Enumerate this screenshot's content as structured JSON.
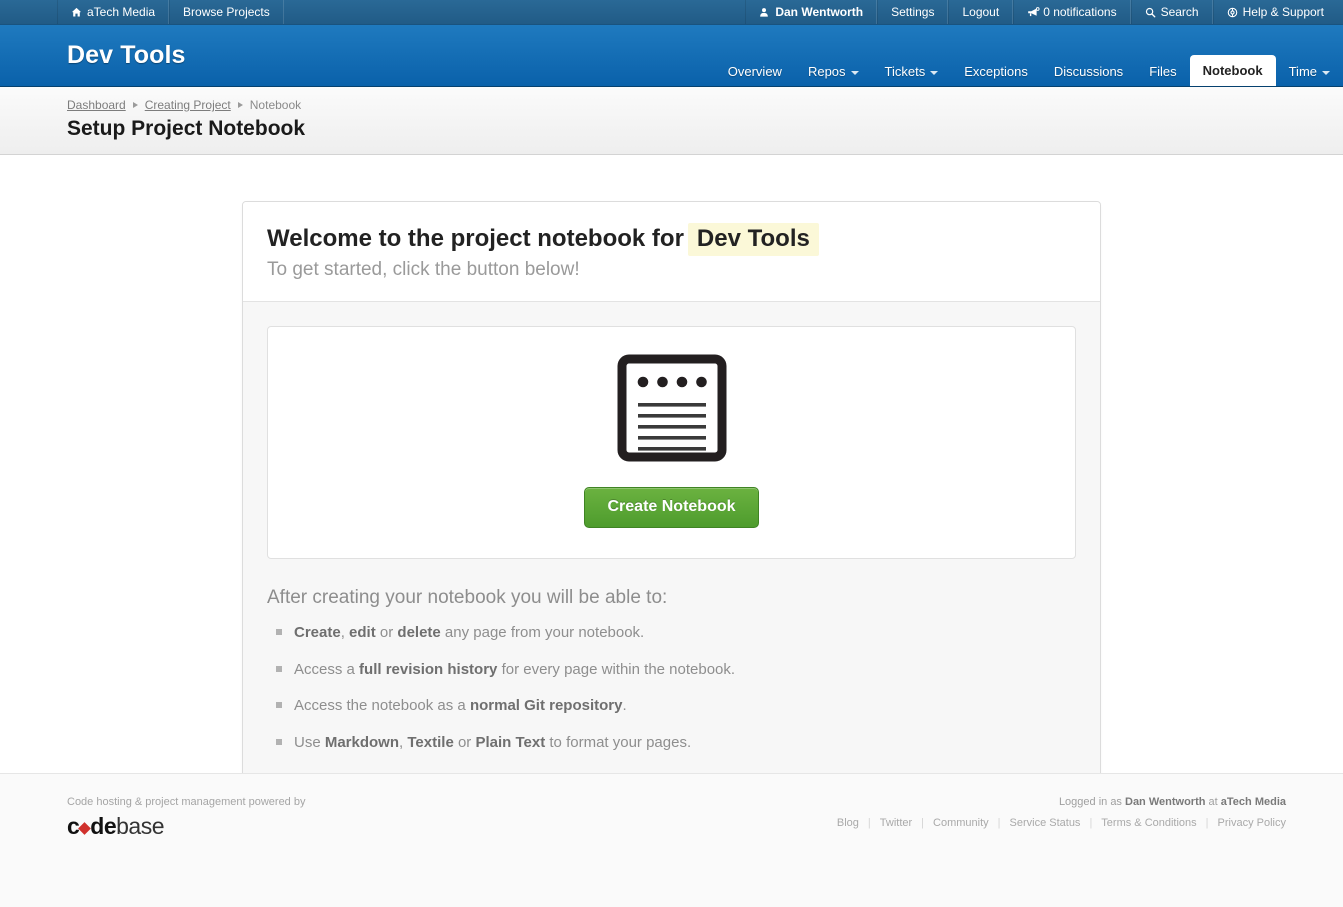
{
  "topbar": {
    "left": [
      {
        "label": "aTech Media",
        "icon": "home-icon",
        "name": "atech-media-link"
      },
      {
        "label": "Browse Projects",
        "icon": null,
        "name": "browse-projects-link"
      }
    ],
    "right": [
      {
        "label": "Dan Wentworth",
        "icon": "user-icon",
        "name": "account-user-link",
        "bold": true
      },
      {
        "label": "Settings",
        "icon": null,
        "name": "settings-link",
        "bold": false
      },
      {
        "label": "Logout",
        "icon": null,
        "name": "logout-link",
        "bold": false
      },
      {
        "label": "0 notifications",
        "icon": "megaphone-icon",
        "name": "notifications-link",
        "bold": false
      },
      {
        "label": "Search",
        "icon": "search-icon",
        "name": "search-link",
        "bold": false
      },
      {
        "label": "Help & Support",
        "icon": "lifebuoy-icon",
        "name": "help-support-link",
        "bold": false
      }
    ]
  },
  "project": {
    "title": "Dev Tools",
    "nav": [
      {
        "label": "Overview",
        "dropdown": false,
        "active": false,
        "name": "nav-overview"
      },
      {
        "label": "Repos",
        "dropdown": true,
        "active": false,
        "name": "nav-repos"
      },
      {
        "label": "Tickets",
        "dropdown": true,
        "active": false,
        "name": "nav-tickets"
      },
      {
        "label": "Exceptions",
        "dropdown": false,
        "active": false,
        "name": "nav-exceptions"
      },
      {
        "label": "Discussions",
        "dropdown": false,
        "active": false,
        "name": "nav-discussions"
      },
      {
        "label": "Files",
        "dropdown": false,
        "active": false,
        "name": "nav-files"
      },
      {
        "label": "Notebook",
        "dropdown": false,
        "active": true,
        "name": "nav-notebook"
      },
      {
        "label": "Time",
        "dropdown": true,
        "active": false,
        "name": "nav-time"
      }
    ]
  },
  "pagehead": {
    "breadcrumb": [
      {
        "label": "Dashboard",
        "link": true
      },
      {
        "label": "Creating Project",
        "link": true
      },
      {
        "label": "Notebook",
        "link": false
      }
    ],
    "title": "Setup Project Notebook"
  },
  "main": {
    "welcome_prefix": "Welcome to the project notebook for",
    "welcome_highlight": "Dev Tools",
    "subtitle": "To get started, click the button below!",
    "create_button": "Create Notebook",
    "after_title": "After creating your notebook you will be able to:",
    "features": [
      [
        {
          "t": "Create",
          "b": true
        },
        {
          "t": ", ",
          "b": false
        },
        {
          "t": "edit",
          "b": true
        },
        {
          "t": " or ",
          "b": false
        },
        {
          "t": "delete",
          "b": true
        },
        {
          "t": " any page from your notebook.",
          "b": false
        }
      ],
      [
        {
          "t": "Access a ",
          "b": false
        },
        {
          "t": "full revision history",
          "b": true
        },
        {
          "t": " for every page within the notebook.",
          "b": false
        }
      ],
      [
        {
          "t": "Access the notebook as a ",
          "b": false
        },
        {
          "t": "normal Git repository",
          "b": true
        },
        {
          "t": ".",
          "b": false
        }
      ],
      [
        {
          "t": "Use ",
          "b": false
        },
        {
          "t": "Markdown",
          "b": true
        },
        {
          "t": ", ",
          "b": false
        },
        {
          "t": "Textile",
          "b": true
        },
        {
          "t": " or ",
          "b": false
        },
        {
          "t": "Plain Text",
          "b": true
        },
        {
          "t": " to format your pages.",
          "b": false
        }
      ]
    ]
  },
  "footer": {
    "powered_by": "Code hosting & project management powered by",
    "logo_part1": "c",
    "logo_part2": "de",
    "logo_part3": "base",
    "logged_in_prefix": "Logged in as",
    "logged_in_user": "Dan Wentworth",
    "logged_in_at": "at",
    "logged_in_org": "aTech Media",
    "links": [
      "Blog",
      "Twitter",
      "Community",
      "Service Status",
      "Terms & Conditions",
      "Privacy Policy"
    ]
  },
  "colors": {
    "topbar": "#215b86",
    "project_band": "#0a61aa",
    "accent_green": "#5aa634",
    "highlight_yellow": "#fbf8d8",
    "logo_red": "#d0312d"
  }
}
